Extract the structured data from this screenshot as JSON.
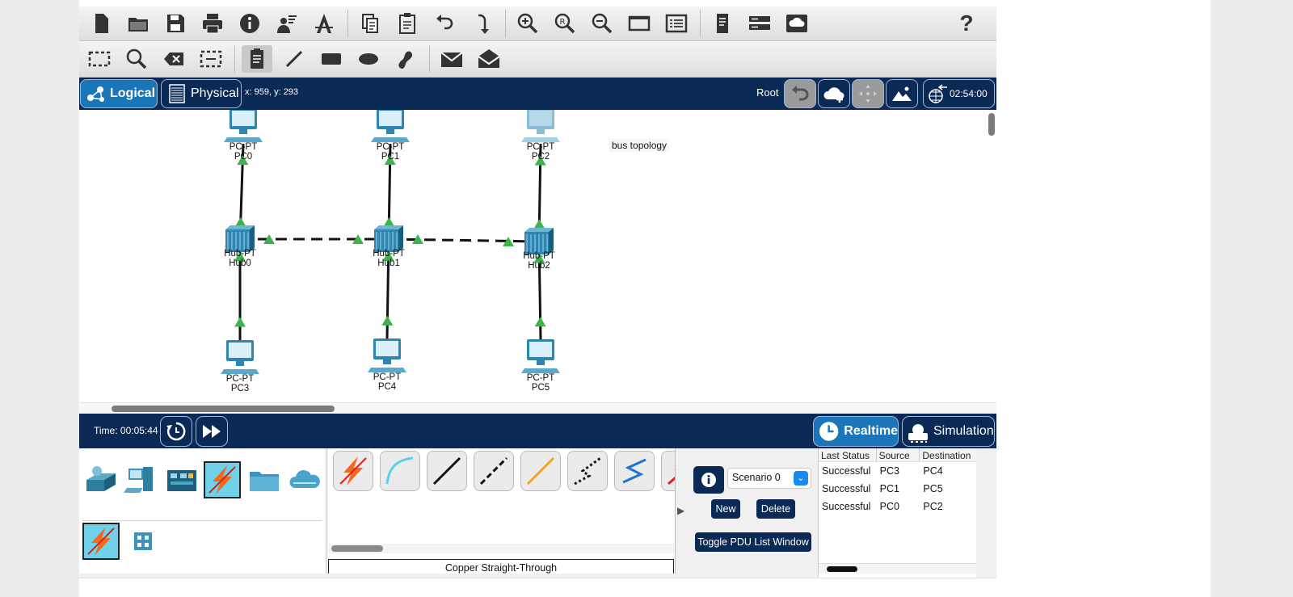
{
  "toolbar1": {
    "tools": [
      "new-file-icon",
      "open-folder-icon",
      "save-icon",
      "print-icon",
      "info-icon",
      "activity-wizard-icon",
      "network-info-icon",
      "copy-icon",
      "paste-icon",
      "undo-icon",
      "redo-icon",
      "zoom-in-icon",
      "zoom-reset-icon",
      "zoom-out-icon",
      "drawing-palette-icon",
      "custom-devices-icon",
      "notes-icon",
      "viewport-icon",
      "cloud-config-icon"
    ],
    "help": "?"
  },
  "toolbar2": {
    "tools": [
      "select-icon",
      "inspect-icon",
      "delete-icon",
      "resize-icon",
      "note-icon",
      "line-icon",
      "rectangle-icon",
      "ellipse-icon",
      "freeform-icon",
      "add-simple-pdu-icon",
      "add-complex-pdu-icon"
    ]
  },
  "viewbar": {
    "logical_label": "Logical",
    "physical_label": "Physical",
    "coords": "x: 959, y: 293",
    "root_label": "Root",
    "clock": "02:54:00"
  },
  "workspace": {
    "note": "bus topology",
    "devices": [
      {
        "id": "pc0",
        "type_label": "PC-PT",
        "name": "PC0"
      },
      {
        "id": "pc1",
        "type_label": "PC-PT",
        "name": "PC1"
      },
      {
        "id": "pc2",
        "type_label": "PC-PT",
        "name": "PC2"
      },
      {
        "id": "hub0",
        "type_label": "Hub-PT",
        "name": "Hub0"
      },
      {
        "id": "hub1",
        "type_label": "Hub-PT",
        "name": "Hub1"
      },
      {
        "id": "hub2",
        "type_label": "Hub-PT",
        "name": "Hub2"
      },
      {
        "id": "pc3",
        "type_label": "PC-PT",
        "name": "PC3"
      },
      {
        "id": "pc4",
        "type_label": "PC-PT",
        "name": "PC4"
      },
      {
        "id": "pc5",
        "type_label": "PC-PT",
        "name": "PC5"
      }
    ]
  },
  "simbar": {
    "time": "Time: 00:05:44",
    "realtime_label": "Realtime",
    "simulation_label": "Simulation"
  },
  "bottom": {
    "connection_name": "Copper Straight-Through",
    "scenario": "Scenario 0",
    "new_label": "New",
    "delete_label": "Delete",
    "toggle_label": "Toggle PDU List Window",
    "pdu_columns": [
      "Last Status",
      "Source",
      "Destination"
    ],
    "pdu_rows": [
      {
        "status": "Successful",
        "source": "PC3",
        "destination": "PC4"
      },
      {
        "status": "Successful",
        "source": "PC1",
        "destination": "PC5"
      },
      {
        "status": "Successful",
        "source": "PC0",
        "destination": "PC2"
      }
    ],
    "accent_color": "#1a76b8",
    "navy_color": "#0a2a55",
    "link_up_color": "#3cb44b"
  }
}
